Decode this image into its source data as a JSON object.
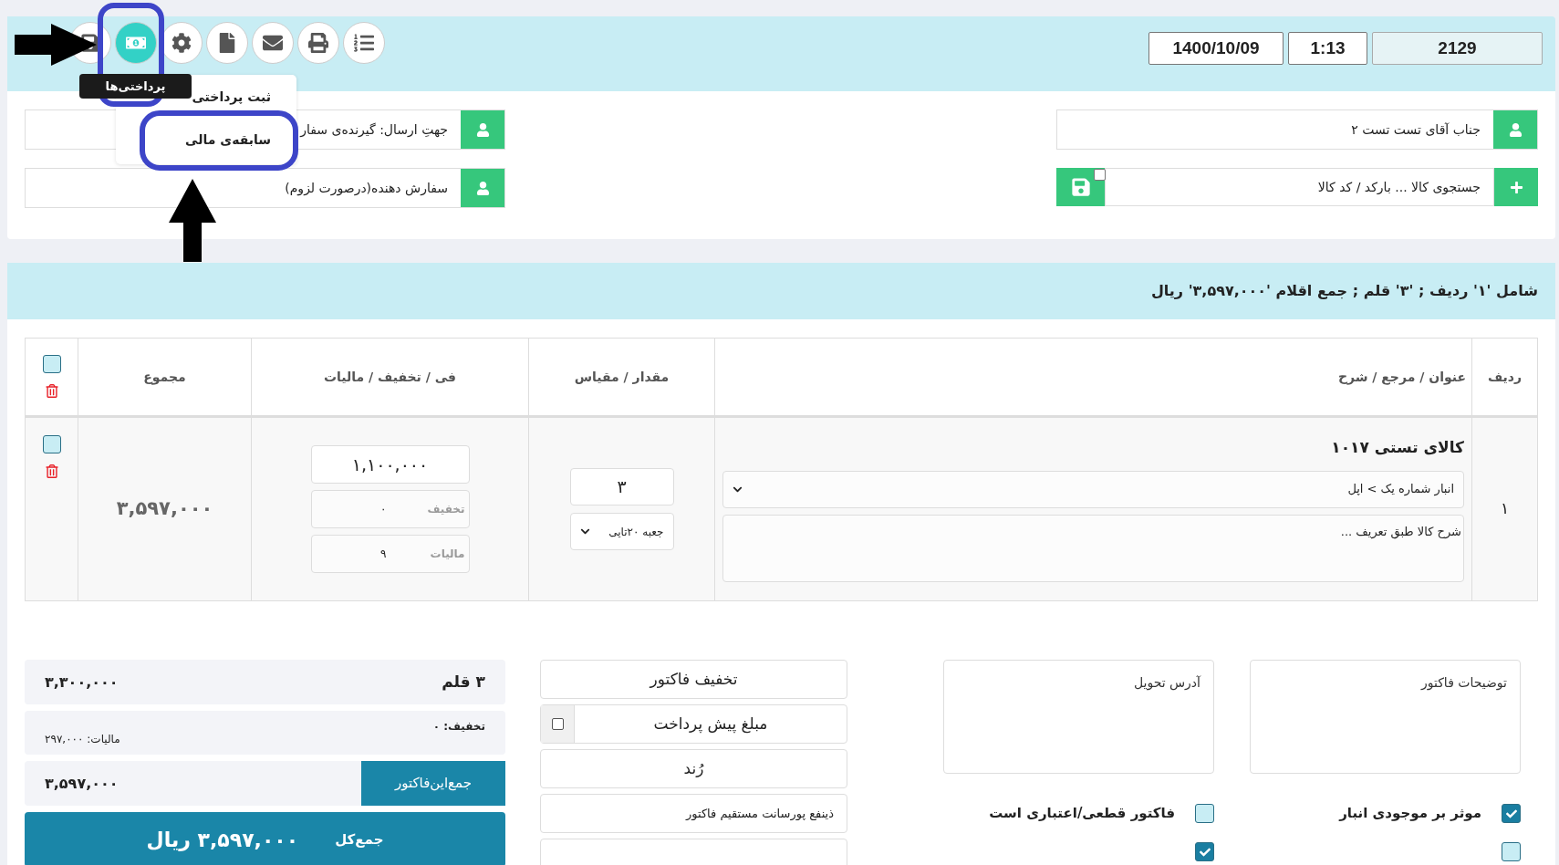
{
  "toolbar": {
    "buttons": [
      {
        "kind": "save",
        "selected": false
      },
      {
        "kind": "payments",
        "selected": true
      },
      {
        "kind": "settings",
        "selected": false
      },
      {
        "kind": "file",
        "selected": false
      },
      {
        "kind": "mail",
        "selected": false
      },
      {
        "kind": "print",
        "selected": false
      },
      {
        "kind": "list",
        "selected": false
      }
    ],
    "tooltip": "پرداختی‌ها",
    "menu": [
      "ثبت پرداختی",
      "سابقه‌ی مالی"
    ]
  },
  "header": {
    "number": "2129",
    "time": "1:13",
    "date": "1400/10/09"
  },
  "customer": {
    "buyer": "جناب آقای تست تست ۲",
    "search_placeholder": "جستجوی کالا ... بارکد / کد کالا",
    "save_checked": false,
    "recipient": "جهتِ ارسال: گیرنده‌ی سفار",
    "orderer": "سفارش دهنده(درصورت لزوم)"
  },
  "summary": "شامل '۱' ردیف ; '۳' قلم ; جمع اقلام '۳,۵۹۷,۰۰۰' ریال",
  "table": {
    "columns": [
      "ردیف",
      "عنوان / مرجع / شرح",
      "مقدار / مقیاس",
      "فی / تخفیف / مالیات",
      "مجموع"
    ],
    "header_checked": false,
    "rows": [
      {
        "index": "۱",
        "title": "کالای تستی ۱۰۱۷",
        "warehouse": "انبار شماره یک > اپل",
        "description_placeholder": "شرح کالا طبق تعریف ...",
        "quantity": "۳",
        "unit": "جعبه ۲۰تایی",
        "price": "۱,۱۰۰,۰۰۰",
        "discount_label": "تخفیف",
        "discount": "۰",
        "tax_label": "مالیات",
        "tax": "۹",
        "total": "۳,۵۹۷,۰۰۰",
        "checked": false
      }
    ]
  },
  "totals": {
    "items": "۳ قلم",
    "subtotal": "۳,۳۰۰,۰۰۰",
    "discount": "تخفیف: ۰",
    "tax": "مالیات: ۲۹۷,۰۰۰",
    "invoice_label": "جمع‌این‌فاکتور",
    "invoice_total": "۳,۵۹۷,۰۰۰",
    "grand_label": "جمع‌کل",
    "grand_total": "۳,۵۹۷,۰۰۰ ریال"
  },
  "actions": [
    {
      "kind": "button",
      "label": "تخفیف فاکتور"
    },
    {
      "kind": "checkbox",
      "label": "مبلغ پیش پرداخت",
      "checked": false
    },
    {
      "kind": "button",
      "label": "رُند"
    },
    {
      "kind": "field",
      "placeholder": "ذینفع پورسانت مستقیم فاکتور"
    },
    {
      "kind": "blank"
    }
  ],
  "notes": [
    {
      "placeholder": "توضیحات فاکتور"
    },
    {
      "placeholder": "آدرس تحویل"
    }
  ],
  "options": [
    {
      "label": "موثر بر موجودی انبار",
      "checked": true
    },
    {
      "label": "فاکتور قطعی/اعتباری است",
      "checked": false
    },
    {
      "checked": false
    },
    {
      "checked": true
    }
  ]
}
